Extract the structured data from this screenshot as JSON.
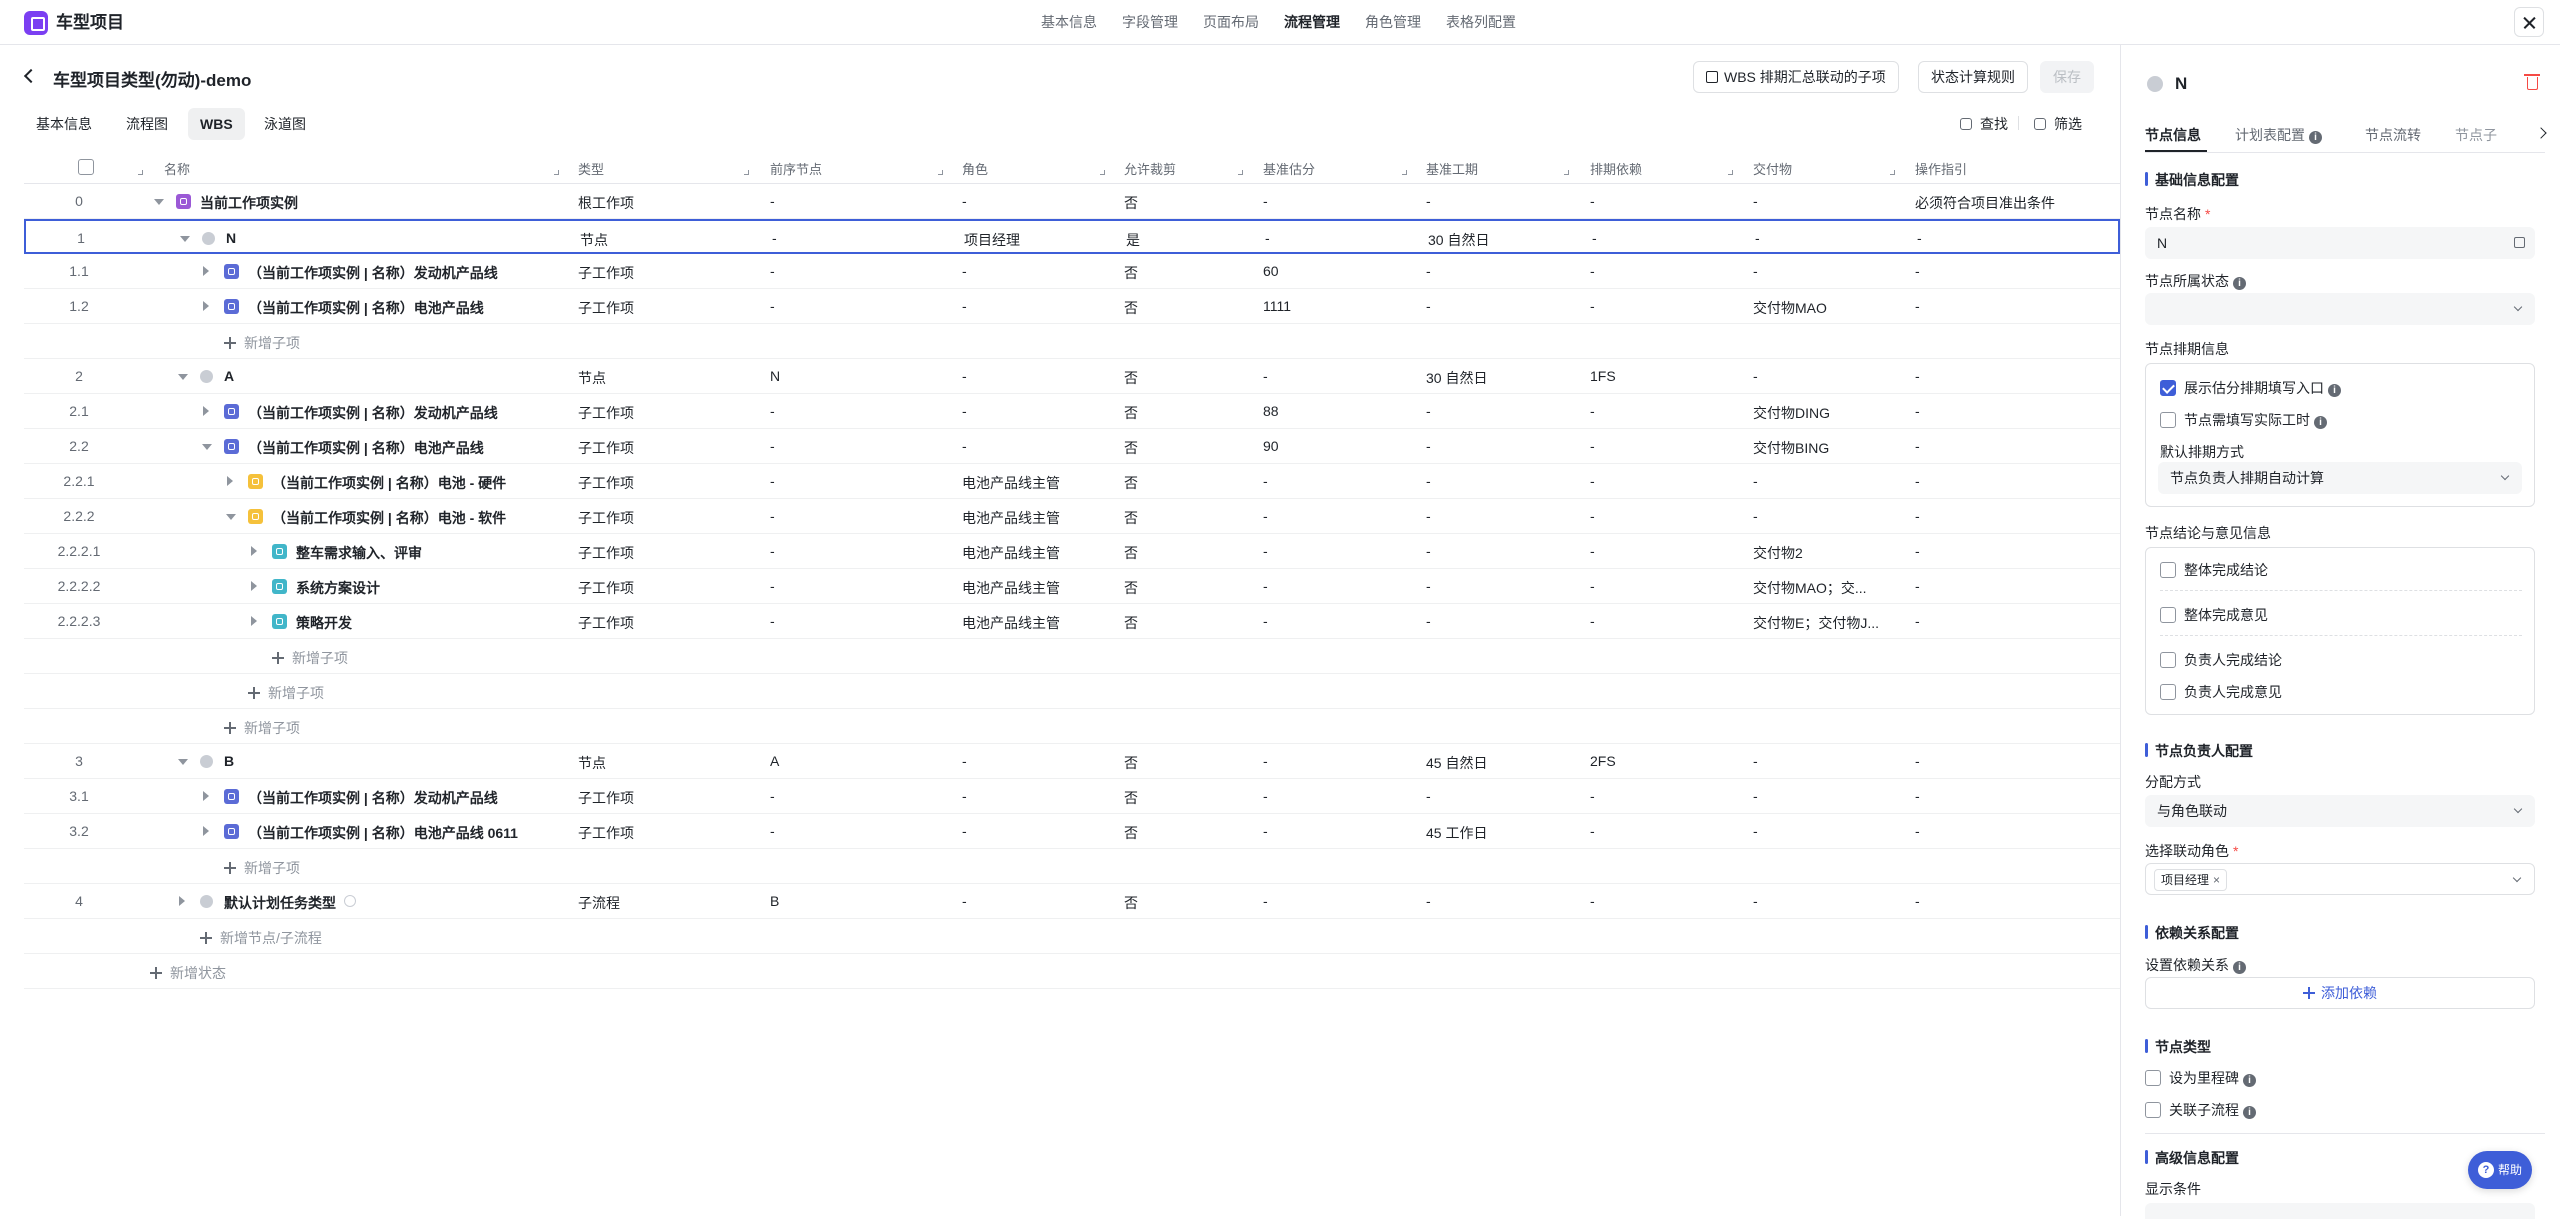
{
  "app": {
    "title": "车型项目"
  },
  "topnav": [
    "基本信息",
    "字段管理",
    "页面布局",
    "流程管理",
    "角色管理",
    "表格列配置"
  ],
  "page": {
    "title": "车型项目类型(勿动)-demo",
    "btn_wbs": "WBS 排期汇总联动的子项",
    "btn_rules": "状态计算规则",
    "btn_save": "保存"
  },
  "tabs": [
    "基本信息",
    "流程图",
    "WBS",
    "泳道图"
  ],
  "tools": {
    "find": "查找",
    "filter": "筛选"
  },
  "columns": [
    "名称",
    "类型",
    "前序节点",
    "角色",
    "允许裁剪",
    "基准估分",
    "基准工期",
    "排期依赖",
    "交付物",
    "操作指引"
  ],
  "rows": [
    {
      "idx": "0",
      "name": "当前工作项实例",
      "type": "根工作项",
      "prev": "-",
      "role": "-",
      "cut": "否",
      "est": "-",
      "dur": "-",
      "dep": "-",
      "del": "-",
      "guide": "必须符合项目准出条件"
    },
    {
      "idx": "1",
      "name": "N",
      "type": "节点",
      "prev": "-",
      "role": "项目经理",
      "cut": "是",
      "est": "-",
      "dur": "30 自然日",
      "dep": "-",
      "del": "-",
      "guide": "-"
    },
    {
      "idx": "1.1",
      "name": "（当前工作项实例 | 名称）发动机产品线",
      "type": "子工作项",
      "prev": "-",
      "role": "-",
      "cut": "否",
      "est": "60",
      "dur": "-",
      "dep": "-",
      "del": "-",
      "guide": "-"
    },
    {
      "idx": "1.2",
      "name": "（当前工作项实例 | 名称）电池产品线",
      "type": "子工作项",
      "prev": "-",
      "role": "-",
      "cut": "否",
      "est": "1111",
      "dur": "-",
      "dep": "-",
      "del": "交付物MAO",
      "guide": "-"
    },
    {
      "add": "新增子项"
    },
    {
      "idx": "2",
      "name": "A",
      "type": "节点",
      "prev": "N",
      "role": "-",
      "cut": "否",
      "est": "-",
      "dur": "30 自然日",
      "dep": "1FS",
      "del": "-",
      "guide": "-"
    },
    {
      "idx": "2.1",
      "name": "（当前工作项实例 | 名称）发动机产品线",
      "type": "子工作项",
      "prev": "-",
      "role": "-",
      "cut": "否",
      "est": "88",
      "dur": "-",
      "dep": "-",
      "del": "交付物DING",
      "guide": "-"
    },
    {
      "idx": "2.2",
      "name": "（当前工作项实例 | 名称）电池产品线",
      "type": "子工作项",
      "prev": "-",
      "role": "-",
      "cut": "否",
      "est": "90",
      "dur": "-",
      "dep": "-",
      "del": "交付物BING",
      "guide": "-"
    },
    {
      "idx": "2.2.1",
      "name": "（当前工作项实例 | 名称）电池 - 硬件",
      "type": "子工作项",
      "prev": "-",
      "role": "电池产品线主管",
      "cut": "否",
      "est": "-",
      "dur": "-",
      "dep": "-",
      "del": "-",
      "guide": "-"
    },
    {
      "idx": "2.2.2",
      "name": "（当前工作项实例 | 名称）电池 - 软件",
      "type": "子工作项",
      "prev": "-",
      "role": "电池产品线主管",
      "cut": "否",
      "est": "-",
      "dur": "-",
      "dep": "-",
      "del": "-",
      "guide": "-"
    },
    {
      "idx": "2.2.2.1",
      "name": "整车需求输入、评审",
      "type": "子工作项",
      "prev": "-",
      "role": "电池产品线主管",
      "cut": "否",
      "est": "-",
      "dur": "-",
      "dep": "-",
      "del": "交付物2",
      "guide": "-"
    },
    {
      "idx": "2.2.2.2",
      "name": "系统方案设计",
      "type": "子工作项",
      "prev": "-",
      "role": "电池产品线主管",
      "cut": "否",
      "est": "-",
      "dur": "-",
      "dep": "-",
      "del": "交付物MAO；交...",
      "guide": "-"
    },
    {
      "idx": "2.2.2.3",
      "name": "策略开发",
      "type": "子工作项",
      "prev": "-",
      "role": "电池产品线主管",
      "cut": "否",
      "est": "-",
      "dur": "-",
      "dep": "-",
      "del": "交付物E；交付物J...",
      "guide": "-"
    },
    {
      "add": "新增子项"
    },
    {
      "add": "新增子项"
    },
    {
      "add": "新增子项"
    },
    {
      "idx": "3",
      "name": "B",
      "type": "节点",
      "prev": "A",
      "role": "-",
      "cut": "否",
      "est": "-",
      "dur": "45 自然日",
      "dep": "2FS",
      "del": "-",
      "guide": "-"
    },
    {
      "idx": "3.1",
      "name": "（当前工作项实例 | 名称）发动机产品线",
      "type": "子工作项",
      "prev": "-",
      "role": "-",
      "cut": "否",
      "est": "-",
      "dur": "-",
      "dep": "-",
      "del": "-",
      "guide": "-"
    },
    {
      "idx": "3.2",
      "name": "（当前工作项实例 | 名称）电池产品线 0611",
      "type": "子工作项",
      "prev": "-",
      "role": "-",
      "cut": "否",
      "est": "-",
      "dur": "45 工作日",
      "dep": "-",
      "del": "-",
      "guide": "-"
    },
    {
      "add": "新增子项"
    },
    {
      "idx": "4",
      "name": "默认计划任务类型",
      "type": "子流程",
      "prev": "B",
      "role": "-",
      "cut": "否",
      "est": "-",
      "dur": "-",
      "dep": "-",
      "del": "-",
      "guide": "-"
    },
    {
      "add": "新增节点/子流程"
    },
    {
      "add": "新增状态"
    }
  ],
  "panel": {
    "node_name": "N",
    "tabs": [
      "节点信息",
      "计划表配置",
      "节点流转",
      "节点子"
    ],
    "sec_basic": "基础信息配置",
    "lbl_name": "节点名称",
    "req": "*",
    "name_value": "N",
    "lbl_state": "节点所属状态",
    "sec_sched": "节点排期信息",
    "cb_show_est": "展示估分排期填写入口",
    "cb_actual": "节点需填写实际工时",
    "lbl_default_sched": "默认排期方式",
    "sched_value": "节点负责人排期自动计算",
    "sec_conclusion": "节点结论与意见信息",
    "cb1": "整体完成结论",
    "cb2": "整体完成意见",
    "cb3": "负责人完成结论",
    "cb4": "负责人完成意见",
    "sec_owner": "节点负责人配置",
    "lbl_assign": "分配方式",
    "assign_value": "与角色联动",
    "lbl_role": "选择联动角色",
    "role_tag": "项目经理",
    "tag_close": "×",
    "sec_dep": "依赖关系配置",
    "lbl_dep": "设置依赖关系",
    "btn_add_dep": "添加依赖",
    "sec_type": "节点类型",
    "cb_milestone": "设为里程碑",
    "cb_subflow": "关联子流程",
    "sec_adv": "高级信息配置",
    "lbl_cond": "显示条件"
  },
  "help": "帮助",
  "colors": {
    "accent": "#3e5ed8",
    "brand": "#7b3ff2",
    "danger": "#f54a45"
  }
}
